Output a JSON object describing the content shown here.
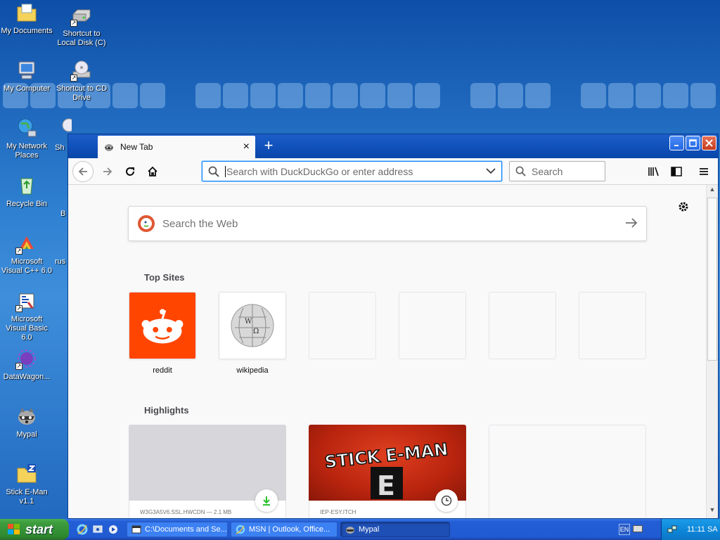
{
  "desktop": {
    "icons": [
      {
        "label": "My Documents",
        "icon": "my-documents-folder-icon"
      },
      {
        "label": "Shortcut to Local Disk (C)",
        "icon": "hard-disk-icon"
      },
      {
        "label": "My Computer",
        "icon": "my-computer-icon"
      },
      {
        "label": "Shortcut to CD Drive",
        "icon": "cd-drive-icon"
      },
      {
        "label": "My Network Places",
        "icon": "network-globe-icon"
      },
      {
        "label": "Sh",
        "icon": "cd-drive-icon"
      },
      {
        "label": "Recycle Bin",
        "icon": "recycle-bin-icon"
      },
      {
        "label": "B",
        "icon": "partial-icon"
      },
      {
        "label": "Microsoft Visual C++ 6.0",
        "icon": "visual-cpp-icon"
      },
      {
        "label": "rus",
        "icon": "partial-icon"
      },
      {
        "label": "Microsoft Visual Basic 6.0",
        "icon": "visual-basic-icon"
      },
      {
        "label": "DataWagon...",
        "icon": "datawagon-icon"
      },
      {
        "label": "Mypal",
        "icon": "mypal-raccoon-icon"
      },
      {
        "label": "Stick E-Man v1.1",
        "icon": "zip-folder-icon"
      }
    ]
  },
  "browser": {
    "tab": {
      "title": "New Tab",
      "close": "×"
    },
    "new_tab": "+",
    "window_buttons": {
      "minimize": "_",
      "maximize": "□",
      "close": "×"
    },
    "url_placeholder": "Search with DuckDuckGo or enter address",
    "search_placeholder": "Search",
    "web_search_placeholder": "Search the Web",
    "top_sites_title": "Top Sites",
    "top_sites": [
      {
        "label": "reddit",
        "icon": "reddit-logo-icon"
      },
      {
        "label": "wikipedia",
        "icon": "wikipedia-globe-icon"
      },
      {
        "label": "",
        "icon": ""
      },
      {
        "label": "",
        "icon": ""
      },
      {
        "label": "",
        "icon": ""
      },
      {
        "label": "",
        "icon": ""
      }
    ],
    "highlights_title": "Highlights",
    "highlights": [
      {
        "source": "W3G3A5V6.SSL.HWCDN — 2.1 MB",
        "badge": "download-icon"
      },
      {
        "source": "IEP-ESY.ITCH",
        "badge": "clock-icon",
        "image_text": "STICK E-MAN",
        "image_letter": "E"
      },
      {
        "source": "",
        "badge": ""
      }
    ]
  },
  "taskbar": {
    "start_label": "start",
    "tasks": [
      {
        "label": "C:\\Documents and Se...",
        "icon": "folder-icon"
      },
      {
        "label": "MSN | Outlook, Office...",
        "icon": "ie-icon"
      },
      {
        "label": "Mypal",
        "icon": "mypal-raccoon-icon",
        "active": true
      }
    ],
    "language": "EN",
    "clock": "11:11 SA"
  },
  "colors": {
    "accent": "#0a84ff",
    "reddit": "#ff4500",
    "xp_blue": "#245ed6",
    "start_green": "#3d9c3d"
  }
}
